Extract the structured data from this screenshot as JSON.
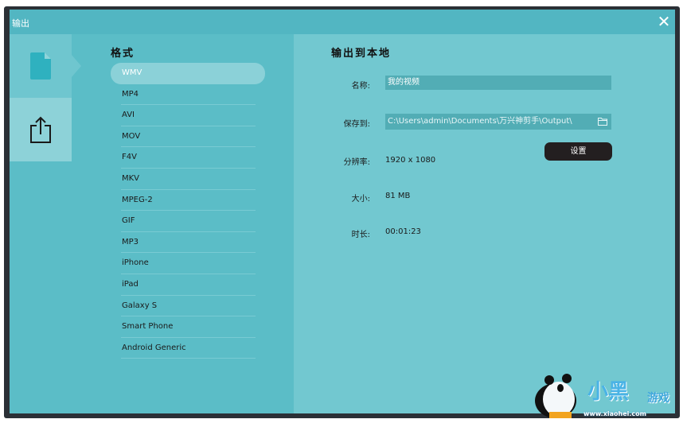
{
  "window": {
    "title": "输出",
    "close_label": "✕"
  },
  "sidebar": {
    "items": [
      {
        "icon": "file-icon",
        "selected": true
      },
      {
        "icon": "share-export-icon",
        "selected": false
      }
    ]
  },
  "format": {
    "heading": "格式",
    "items": [
      "WMV",
      "MP4",
      "AVI",
      "MOV",
      "F4V",
      "MKV",
      "MPEG-2",
      "GIF",
      "MP3",
      "iPhone",
      "iPad",
      "Galaxy S",
      "Smart Phone",
      "Android Generic"
    ],
    "selected": "WMV"
  },
  "output": {
    "heading": "输出到本地",
    "name_label": "名称:",
    "name_value": "我的视频",
    "save_label": "保存到:",
    "save_path": "C:\\Users\\admin\\Documents\\万兴神剪手\\Output\\",
    "resolution_label": "分辨率:",
    "resolution_value": "1920 x 1080",
    "settings_button": "设置",
    "size_label": "大小:",
    "size_value": "81 MB",
    "duration_label": "时长:",
    "duration_value": "00:01:23"
  },
  "watermark": {
    "logo_text": "小黑游戏",
    "url": "www.xiaohei.com"
  }
}
